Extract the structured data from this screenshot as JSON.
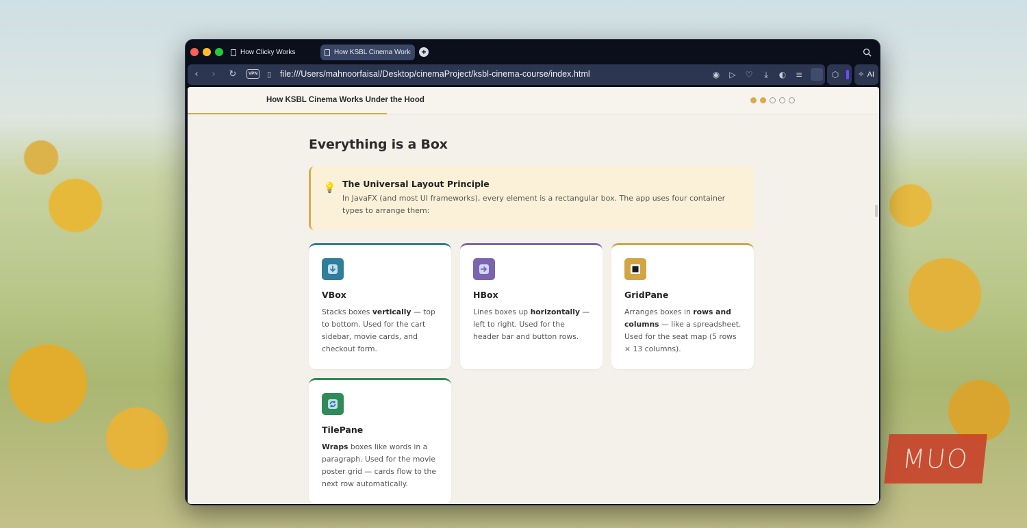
{
  "browser": {
    "tabs": [
      {
        "label": "How Clicky Works"
      },
      {
        "label": "How KSBL Cinema Works Under the Hood"
      }
    ],
    "vpn_label": "VPN",
    "url": "file:///Users/mahnoorfaisal/Desktop/cinemaProject/ksbl-cinema-course/index.html",
    "ai_label": "AI",
    "icons": [
      "back-icon",
      "forward-icon",
      "reload-icon",
      "document-icon",
      "camera-icon",
      "play-icon",
      "heart-icon",
      "download-icon",
      "battery-icon",
      "menu-icon",
      "profile-icon",
      "cube-icon",
      "ai-sparkle-icon",
      "search-icon"
    ]
  },
  "page": {
    "nav_title": "How KSBL Cinema Works Under the Hood",
    "progress_dots": {
      "total": 5,
      "active": [
        0,
        1
      ]
    },
    "heading": "Everything is a Box",
    "callout": {
      "title": "The Universal Layout Principle",
      "text": "In JavaFX (and most UI frameworks), every element is a rectangular box. The app uses four container types to arrange them:"
    },
    "cards": [
      {
        "title": "VBox",
        "pre": "Stacks boxes ",
        "bold": "vertically",
        "post": " — top to bottom. Used for the cart sidebar, movie cards, and checkout form.",
        "accent": "#2f7e9a",
        "icon": "down-arrow-icon"
      },
      {
        "title": "HBox",
        "pre": "Lines boxes up ",
        "bold": "horizontally",
        "post": " — left to right. Used for the header bar and button rows.",
        "accent": "#7a64b0",
        "icon": "right-arrow-icon"
      },
      {
        "title": "GridPane",
        "pre": "Arranges boxes in ",
        "bold": "rows and columns",
        "post": " — like a spreadsheet. Used for the seat map (5 rows × 13 columns).",
        "accent": "#d3a542",
        "icon": "square-icon"
      },
      {
        "title": "TilePane",
        "pre": "",
        "bold": "Wraps",
        "post": " boxes like words in a paragraph. Used for the movie poster grid — cards flow to the next row automatically.",
        "accent": "#2f8b57",
        "icon": "cycle-icon"
      }
    ]
  },
  "watermark": "MUO"
}
